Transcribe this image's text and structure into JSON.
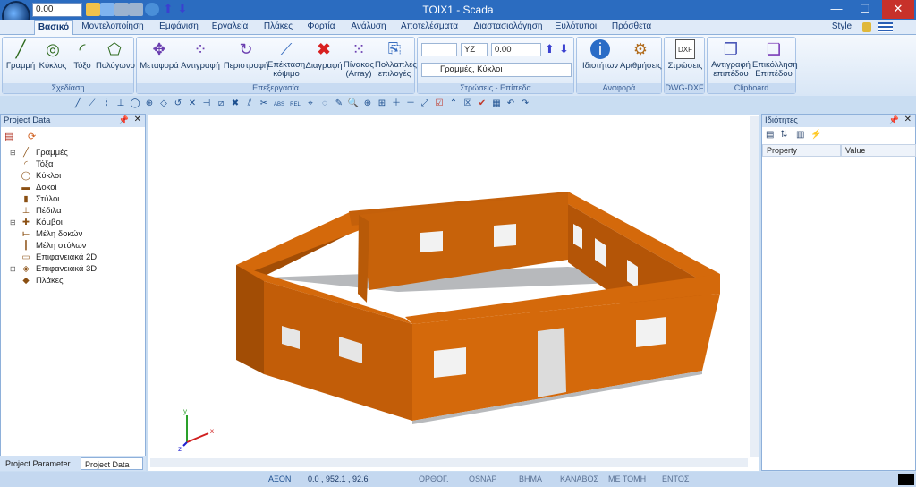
{
  "window": {
    "title": "TOIX1 - Scada",
    "minimize": "—",
    "maximize": "☐",
    "close": "✕"
  },
  "quick": {
    "value": "0.00"
  },
  "menu": {
    "tabs": [
      "Βασικό",
      "Μοντελοποίηση",
      "Εμφάνιση",
      "Εργαλεία",
      "Πλάκες",
      "Φορτία",
      "Ανάλυση",
      "Αποτελέσματα",
      "Διαστασιολόγηση",
      "Ξυλότυποι",
      "Πρόσθετα"
    ],
    "style_label": "Style"
  },
  "ribbon": {
    "groups": {
      "sxediasi": "Σχεδίαση",
      "epexergasia": "Επεξεργασία",
      "stroseis": "Στρώσεις - Επίπεδα",
      "anafora": "Αναφορά",
      "dwg": "DWG-DXF",
      "clipboard": "Clipboard"
    },
    "sxediasi": [
      "Γραμμή",
      "Κύκλος",
      "Τόξο",
      "Πολύγωνο"
    ],
    "epexergasia": [
      "Μεταφορά",
      "Αντιγραφή",
      "Περιστροφή",
      "Επέκταση κόψιμο",
      "Διαγραφή",
      "Πίνακας (Array)",
      "Πολλαπλές επιλογές"
    ],
    "plane": "YZ",
    "offset": "0.00",
    "layer": "Γραμμές, Κύκλοι",
    "anafora": [
      "Ιδιοτήτων",
      "Αριθμήσεις"
    ],
    "dwg": [
      "Στρώσεις"
    ],
    "clipboard": [
      "Αντιγραφή επιπέδου",
      "Επικόλληση Επιπέδου"
    ]
  },
  "project": {
    "title": "Project Data",
    "items": [
      "Γραμμές",
      "Τόξα",
      "Κύκλοι",
      "Δοκοί",
      "Στύλοι",
      "Πέδιλα",
      "Κόμβοι",
      "Μέλη δοκών",
      "Μέλη στύλων",
      "Επιφανειακά 2D",
      "Επιφανειακά 3D",
      "Πλάκες"
    ],
    "tab1": "Project Parameter",
    "tab2": "Project Data"
  },
  "properties": {
    "title": "Ιδιότητες",
    "col1": "Property",
    "col2": "Value"
  },
  "axes": {
    "x": "x",
    "y": "y",
    "z": "z"
  },
  "status": {
    "axon": "ΑΞΟΝ",
    "coords": "0.0 , 952.1 , 92.6",
    "orthog": "ΟΡΘΟΓ.",
    "osnap": "OSNAP",
    "vima": "ΒΗΜΑ",
    "kanavos": "ΚΑΝΑΒΟΣ",
    "metomi": "ΜΕ ΤΟΜΗ",
    "entos": "ΕΝΤΟΣ"
  },
  "colors": {
    "wall": "#d4690b",
    "wall_dark": "#a24d05",
    "floor": "#c3c5c9",
    "accent": "#2b6cc0"
  }
}
